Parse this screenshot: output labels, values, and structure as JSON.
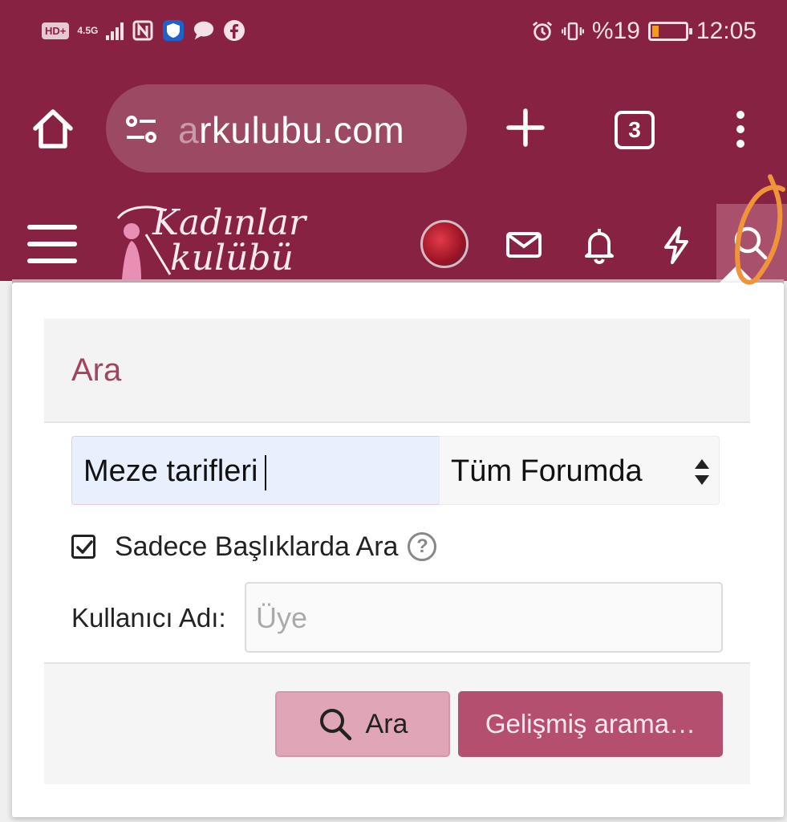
{
  "status_bar": {
    "network_badge": "HD+",
    "network_type": "4.5G",
    "battery_text": "%19",
    "time": "12:05",
    "battery_level": 0.19,
    "icons": [
      "hd-icon",
      "signal-icon",
      "nfc-icon",
      "shield-app-icon",
      "chat-app-icon",
      "facebook-icon",
      "alarm-icon",
      "vibrate-icon",
      "battery-icon"
    ]
  },
  "browser": {
    "url_visible": "arkulubu.com",
    "url_faded_char": "a",
    "url_rest": "rkulubu.com",
    "tab_count": "3"
  },
  "site": {
    "logo_line1": "Kadınlar",
    "logo_line2": "kulübü",
    "header_icons": [
      "menu-icon",
      "avatar",
      "mail-icon",
      "bell-icon",
      "bolt-icon",
      "search-icon"
    ]
  },
  "search_panel": {
    "title": "Ara",
    "keywords_value": "Meze tarifleri",
    "scope_selected": "Tüm Forumda",
    "titles_only_label": "Sadece Başlıklarda Ara",
    "titles_only_checked": true,
    "help_glyph": "?",
    "username_label": "Kullanıcı Adı:",
    "username_placeholder": "Üye",
    "search_button": "Ara",
    "advanced_button": "Gelişmiş arama…"
  },
  "colors": {
    "brand": "#872243",
    "accent": "#b54f6f",
    "button_light": "#e0a6b7",
    "title": "#a3445f",
    "annotation": "#f0943a"
  }
}
